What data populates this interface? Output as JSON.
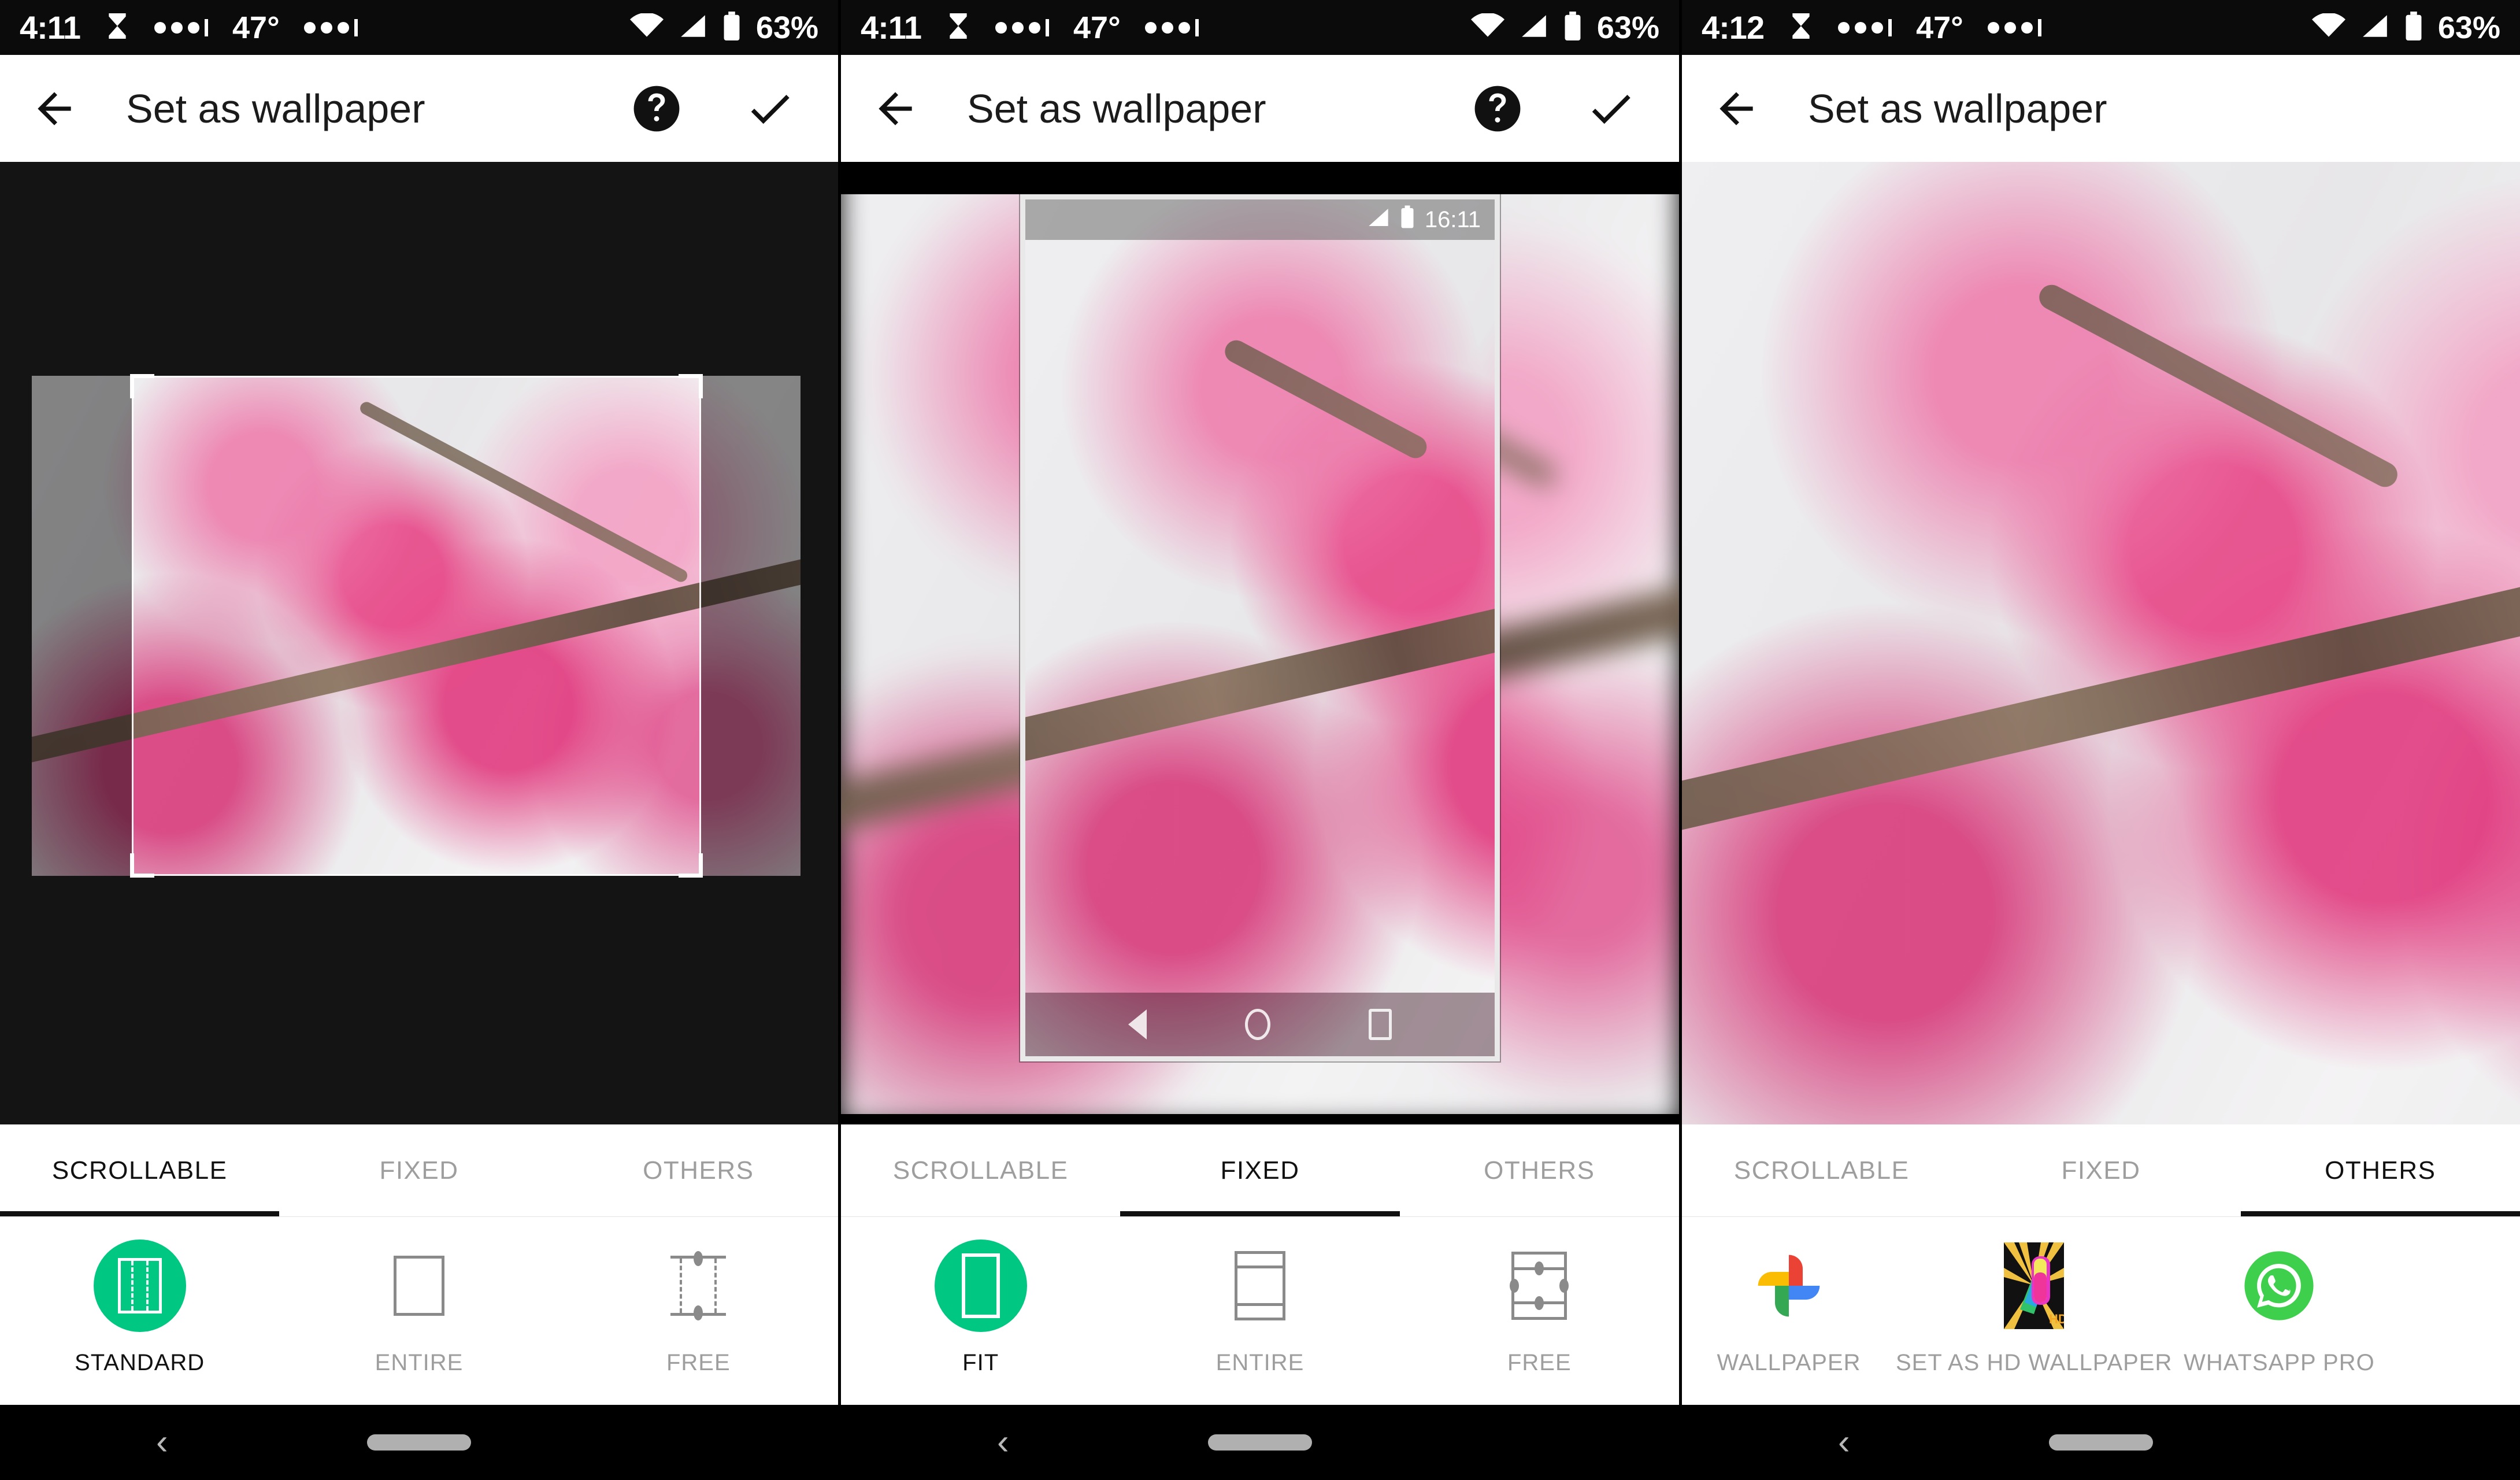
{
  "app": {
    "title": "Set as wallpaper"
  },
  "panels": [
    {
      "id": "panel-scrollable",
      "status": {
        "time": "4:11",
        "temp": "47°",
        "battery": "63%",
        "icons": [
          "hourglass-icon",
          "dots-icon",
          "dots-icon",
          "wifi-icon",
          "signal-icon",
          "battery-icon"
        ]
      },
      "toolbar": {
        "back": "back-arrow-icon",
        "title": "Set as wallpaper",
        "help": "help-circle-icon",
        "confirm": "check-icon"
      },
      "tabs": [
        {
          "label": "SCROLLABLE",
          "active": true
        },
        {
          "label": "FIXED",
          "active": false
        },
        {
          "label": "OTHERS",
          "active": false
        }
      ],
      "options": [
        {
          "label": "STANDARD",
          "selected": true,
          "icon": "standard-crop-icon"
        },
        {
          "label": "ENTIRE",
          "selected": false,
          "icon": "entire-crop-icon"
        },
        {
          "label": "FREE",
          "selected": false,
          "icon": "free-crop-icon"
        }
      ]
    },
    {
      "id": "panel-fixed",
      "status": {
        "time": "4:11",
        "temp": "47°",
        "battery": "63%"
      },
      "toolbar": {
        "title": "Set as wallpaper"
      },
      "preview": {
        "status_time": "16:11",
        "nav": [
          "back-triangle-icon",
          "home-circle-icon",
          "recents-square-icon"
        ]
      },
      "tabs": [
        {
          "label": "SCROLLABLE",
          "active": false
        },
        {
          "label": "FIXED",
          "active": true
        },
        {
          "label": "OTHERS",
          "active": false
        }
      ],
      "options": [
        {
          "label": "FIT",
          "selected": true,
          "icon": "fit-crop-icon"
        },
        {
          "label": "ENTIRE",
          "selected": false,
          "icon": "entire-crop-icon"
        },
        {
          "label": "FREE",
          "selected": false,
          "icon": "free-crop-icon"
        }
      ]
    },
    {
      "id": "panel-others",
      "status": {
        "time": "4:12",
        "temp": "47°",
        "battery": "63%"
      },
      "toolbar": {
        "title": "Set as wallpaper"
      },
      "tabs": [
        {
          "label": "SCROLLABLE",
          "active": false
        },
        {
          "label": "FIXED",
          "active": false
        },
        {
          "label": "OTHERS",
          "active": true
        }
      ],
      "options": [
        {
          "label": "WALLPAPER",
          "icon": "google-photos-icon"
        },
        {
          "label": "SET AS HD WALLPAPER",
          "icon": "hd-wallpaper-app-icon"
        },
        {
          "label": "WHATSAPP PRO",
          "icon": "whatsapp-icon"
        }
      ]
    }
  ],
  "colors": {
    "accent": "#00C782",
    "toolbar_text": "#1b1b1b",
    "tab_inactive": "#9e9e9e",
    "status_bg": "#0b0b0b"
  },
  "gesture_nav": {
    "back": "back-chevron-icon",
    "home": "home-pill-indicator"
  }
}
